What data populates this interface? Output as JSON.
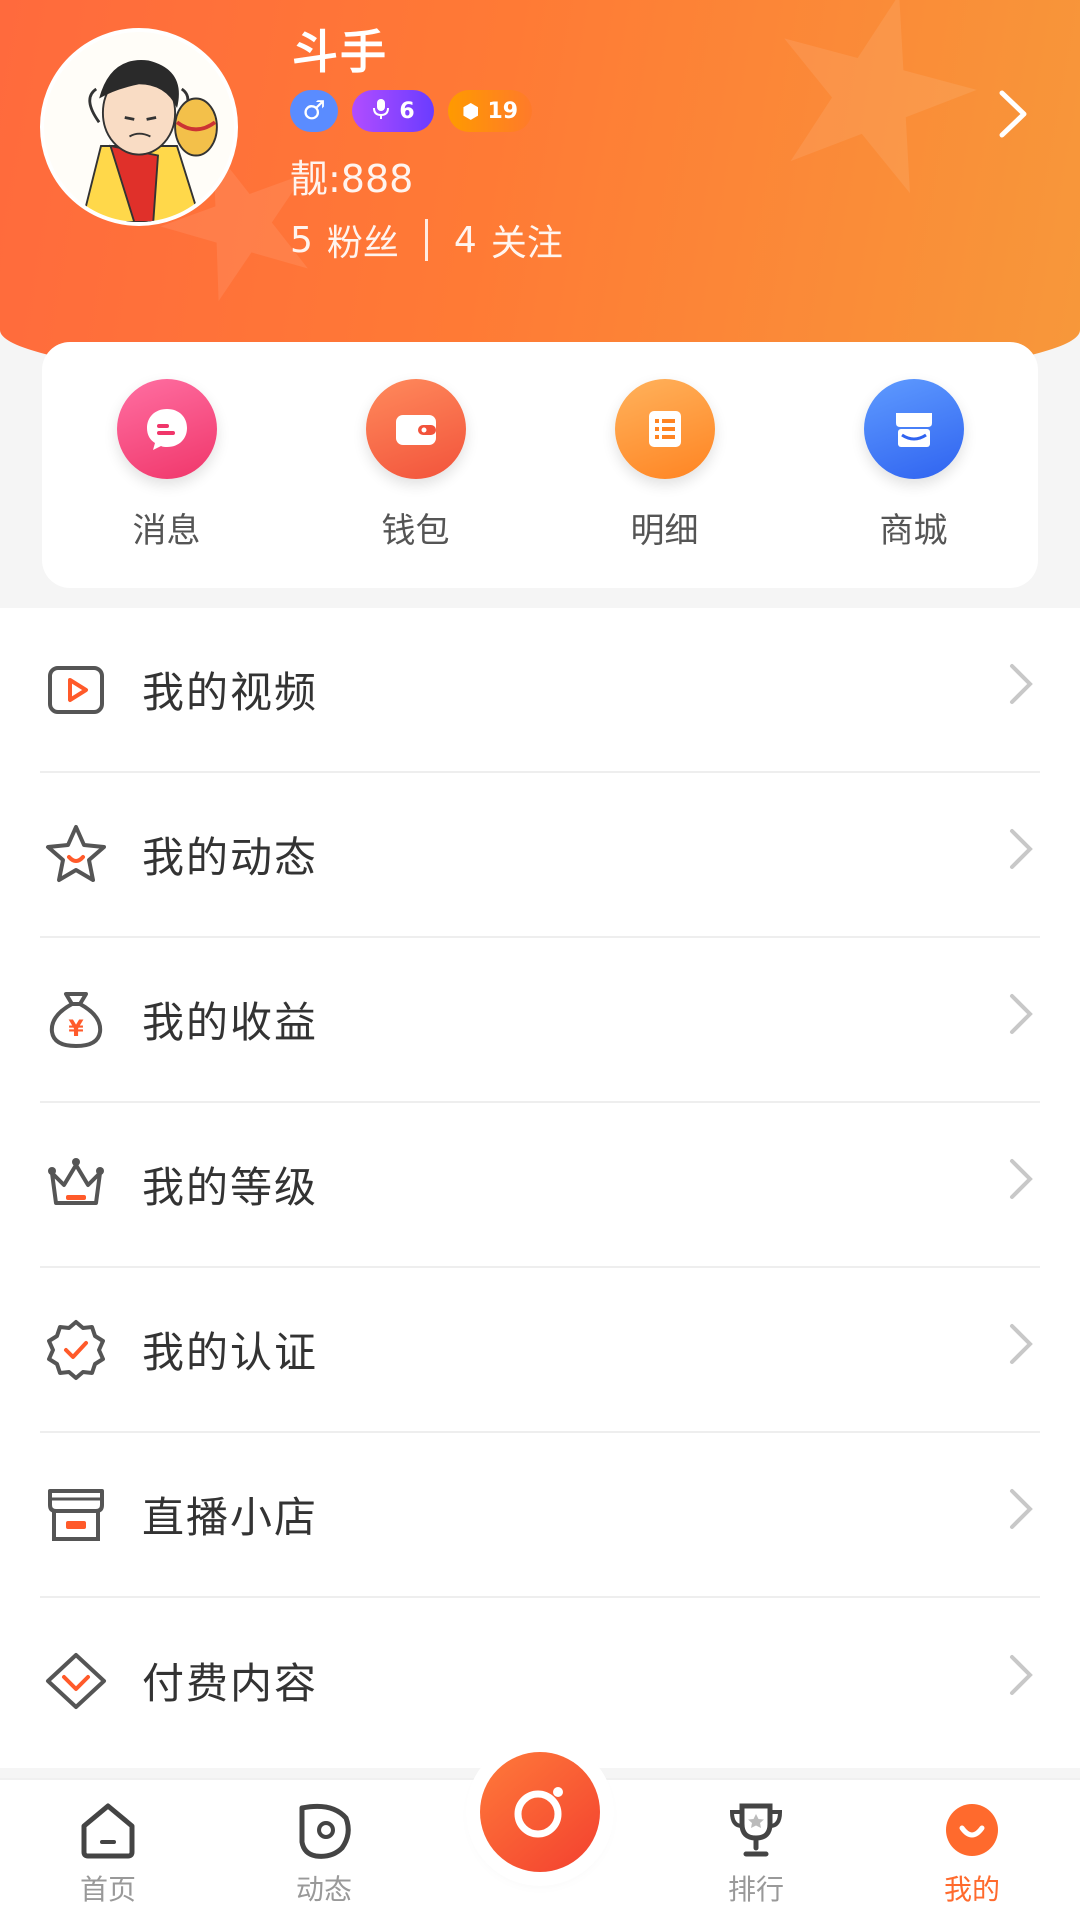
{
  "profile": {
    "username": "斗手",
    "badges": {
      "gender_icon": "male-icon",
      "mic_level": "6",
      "coin_level": "19"
    },
    "beauty_number": "靓:888",
    "fans_count": "5",
    "fans_label": "粉丝",
    "following_count": "4",
    "following_label": "关注"
  },
  "quick_actions": [
    {
      "label": "消息",
      "icon": "message-icon",
      "color": "#f0366a"
    },
    {
      "label": "钱包",
      "icon": "wallet-icon",
      "color": "#f2533b"
    },
    {
      "label": "明细",
      "icon": "list-icon",
      "color": "#ff8422"
    },
    {
      "label": "商城",
      "icon": "shop-icon",
      "color": "#2f63f0"
    }
  ],
  "menu": [
    {
      "label": "我的视频",
      "icon": "video-icon"
    },
    {
      "label": "我的动态",
      "icon": "star-icon"
    },
    {
      "label": "我的收益",
      "icon": "money-bag-icon"
    },
    {
      "label": "我的等级",
      "icon": "crown-icon"
    },
    {
      "label": "我的认证",
      "icon": "certified-icon"
    },
    {
      "label": "直播小店",
      "icon": "store-icon"
    },
    {
      "label": "付费内容",
      "icon": "diamond-icon"
    }
  ],
  "tabbar": {
    "items": [
      {
        "label": "首页",
        "icon": "home-icon"
      },
      {
        "label": "动态",
        "icon": "moments-icon"
      },
      {
        "label": "排行",
        "icon": "trophy-icon"
      },
      {
        "label": "我的",
        "icon": "me-icon"
      }
    ],
    "active_color": "#ff6a2d",
    "center_icon": "live-camera-icon"
  },
  "colors": {
    "header_start": "#ff6a3d",
    "header_end": "#f7983a",
    "accent": "#ff6a2d"
  }
}
